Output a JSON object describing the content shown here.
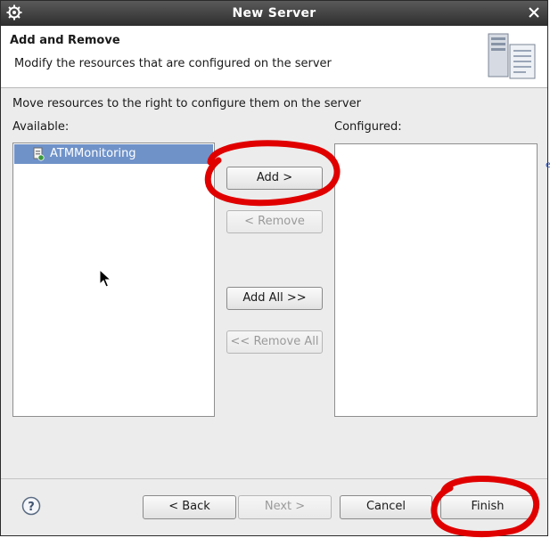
{
  "window": {
    "title": "New Server"
  },
  "header": {
    "title": "Add and Remove",
    "description": "Modify the resources that are configured on the server"
  },
  "main": {
    "instruction": "Move resources to the right to configure them on the server",
    "available_label": "Available:",
    "configured_label": "Configured:",
    "available_items": [
      {
        "label": "ATMMonitoring",
        "icon": "web-module-icon",
        "selected": true
      }
    ],
    "configured_items": []
  },
  "buttons": {
    "add": "Add >",
    "remove": "< Remove",
    "add_all": "Add All >>",
    "remove_all": "<< Remove All"
  },
  "footer": {
    "back": "< Back",
    "next": "Next >",
    "cancel": "Cancel",
    "finish": "Finish"
  },
  "colors": {
    "titlebar": "#3a3a3a",
    "selection": "#6f92c9",
    "annotation": "#e00000"
  }
}
